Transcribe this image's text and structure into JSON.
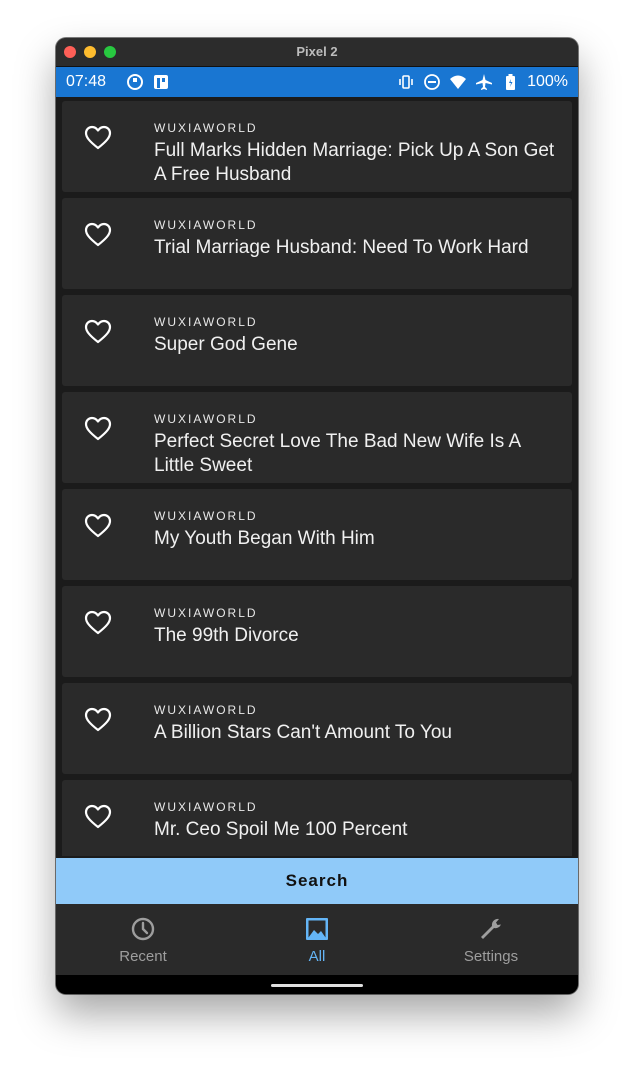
{
  "window": {
    "title": "Pixel 2"
  },
  "status_bar": {
    "time": "07:48",
    "battery": "100%"
  },
  "novels": [
    {
      "source": "WUXIAWORLD",
      "title": "Full Marks Hidden Marriage: Pick Up A Son Get A Free Husband"
    },
    {
      "source": "WUXIAWORLD",
      "title": "Trial Marriage Husband: Need To Work Hard"
    },
    {
      "source": "WUXIAWORLD",
      "title": "Super God Gene"
    },
    {
      "source": "WUXIAWORLD",
      "title": "Perfect Secret Love The Bad New Wife Is A Little Sweet"
    },
    {
      "source": "WUXIAWORLD",
      "title": "My Youth Began With Him"
    },
    {
      "source": "WUXIAWORLD",
      "title": "The 99th Divorce"
    },
    {
      "source": "WUXIAWORLD",
      "title": "A Billion Stars Can't Amount To You"
    },
    {
      "source": "WUXIAWORLD",
      "title": "Mr. Ceo Spoil Me 100 Percent"
    }
  ],
  "search": {
    "label": "Search"
  },
  "bottom_nav": [
    {
      "label": "Recent",
      "icon": "clock-icon",
      "active": false
    },
    {
      "label": "All",
      "icon": "image-icon",
      "active": true
    },
    {
      "label": "Settings",
      "icon": "wrench-icon",
      "active": false
    }
  ],
  "colors": {
    "status_bar": "#1976d2",
    "search_bar": "#90caf9",
    "accent": "#64b5f6",
    "card": "#2a2a2a"
  }
}
